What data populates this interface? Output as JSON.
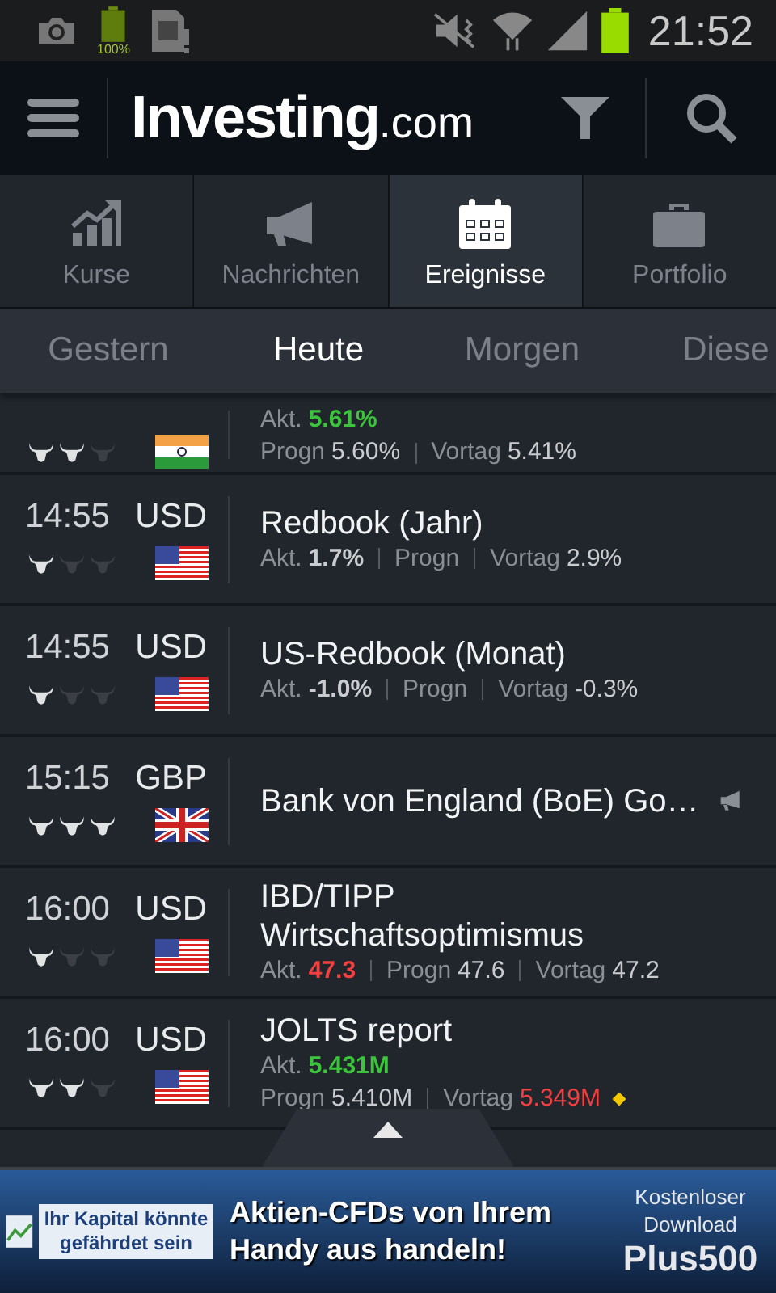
{
  "status_bar": {
    "battery_label": "100%",
    "time": "21:52"
  },
  "app_bar": {
    "logo": "Investing",
    "logo_suffix": ".com"
  },
  "tabs": [
    {
      "label": "Kurse",
      "selected": false
    },
    {
      "label": "Nachrichten",
      "selected": false
    },
    {
      "label": "Ereignisse",
      "selected": true
    },
    {
      "label": "Portfolio",
      "selected": false
    }
  ],
  "day_tabs": [
    {
      "label": "Gestern",
      "selected": false
    },
    {
      "label": "Heute",
      "selected": true
    },
    {
      "label": "Morgen",
      "selected": false
    },
    {
      "label": "Diese",
      "selected": false
    }
  ],
  "events": [
    {
      "kind": "split",
      "stars": 2,
      "flag": {
        "kind": "india"
      },
      "actual": {
        "label": "Akt.",
        "value": "5.61%",
        "color": "#3cc43c"
      },
      "forecast": {
        "label": "Progn",
        "value": "5.60%"
      },
      "previous": {
        "label": "Vortag",
        "value": "5.41%"
      }
    },
    {
      "kind": "inline",
      "time": "14:55",
      "currency": "USD",
      "stars": 1,
      "flag": {
        "kind": "usa"
      },
      "title": "Redbook (Jahr)",
      "actual": {
        "label": "Akt.",
        "value": "1.7%"
      },
      "forecast": {
        "label": "Progn"
      },
      "previous": {
        "label": "Vortag",
        "value": "2.9%"
      }
    },
    {
      "kind": "inline",
      "time": "14:55",
      "currency": "USD",
      "stars": 1,
      "flag": {
        "kind": "usa"
      },
      "title": "US-Redbook (Monat)",
      "actual": {
        "label": "Akt.",
        "value": "-1.0%"
      },
      "forecast": {
        "label": "Progn"
      },
      "previous": {
        "label": "Vortag",
        "value": "-0.3%"
      }
    },
    {
      "kind": "speech",
      "time": "15:15",
      "currency": "GBP",
      "stars": 3,
      "flag": {
        "kind": "uk"
      },
      "title": "Bank von England (BoE) Go…"
    },
    {
      "kind": "inline",
      "time": "16:00",
      "currency": "USD",
      "stars": 1,
      "flag": {
        "kind": "usa"
      },
      "title": "IBD/TIPP Wirtschaftsoptimismus",
      "actual": {
        "label": "Akt.",
        "value": "47.3",
        "color": "#f04040"
      },
      "forecast": {
        "label": "Progn",
        "value": "47.6"
      },
      "previous": {
        "label": "Vortag",
        "value": "47.2"
      }
    },
    {
      "kind": "split",
      "time": "16:00",
      "currency": "USD",
      "stars": 2,
      "flag": {
        "kind": "usa"
      },
      "title": "JOLTS report",
      "actual": {
        "label": "Akt.",
        "value": "5.431M",
        "color": "#3cc43c"
      },
      "forecast": {
        "label": "Progn",
        "value": "5.410M"
      },
      "previous": {
        "label": "Vortag",
        "value": "5.349M",
        "color": "#f04040"
      },
      "revised": true
    }
  ],
  "ad": {
    "warning": "Ihr Kapital könnte gefährdet sein",
    "headline": "Aktien-CFDs von Ihrem Handy aus handeln!",
    "cta": "Kostenloser Download",
    "brand": "Plus500"
  }
}
